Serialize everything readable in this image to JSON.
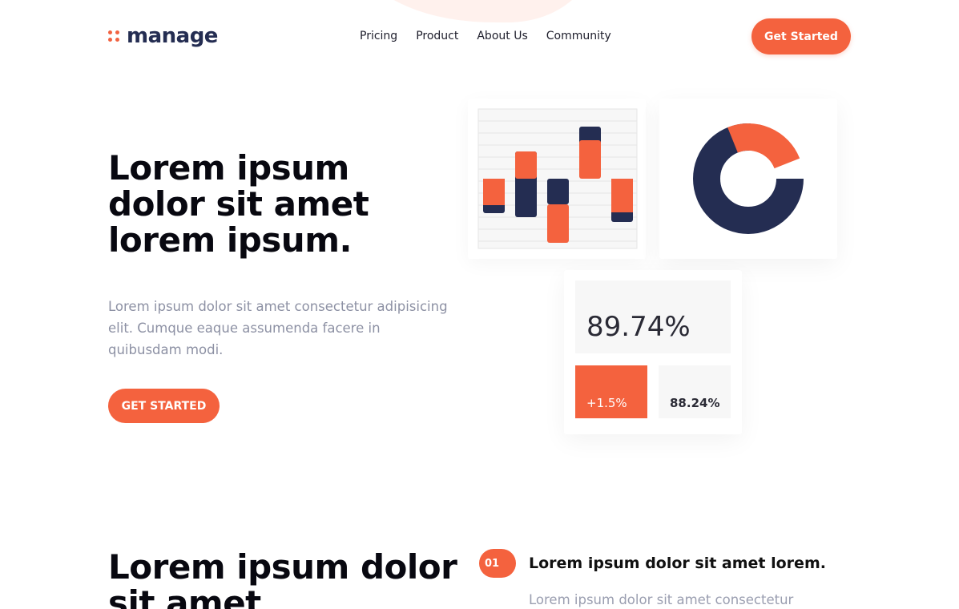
{
  "header": {
    "logo_text": "manage",
    "nav": [
      "Pricing",
      "Product",
      "About Us",
      "Community"
    ],
    "cta_label": "Get Started"
  },
  "hero": {
    "title": "Lorem ipsum dolor sit amet lorem ipsum.",
    "description": "Lorem ipsum dolor sit amet consectetur adipisicing elit. Cumque eaque assumenda facere in quibusdam modi.",
    "cta_label": "GET STARTED"
  },
  "dashboard": {
    "main_stat": "89.74%",
    "stat_a": "+1.5%",
    "stat_b": "88.24%"
  },
  "section2": {
    "title": "Lorem ipsum dolor sit amet",
    "feature": {
      "number": "01",
      "title": "Lorem ipsum dolor sit amet lorem.",
      "description": "Lorem ipsum dolor sit amet consectetur"
    }
  },
  "colors": {
    "accent": "#f4623e",
    "navy": "#242d52",
    "blob": "#fff1ed"
  },
  "icons": [
    "logo-dots-icon"
  ]
}
